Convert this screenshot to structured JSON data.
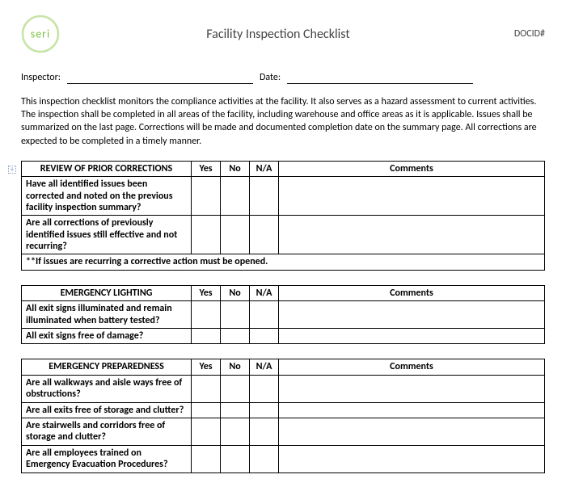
{
  "header": {
    "logo_text": "seri",
    "title": "Facility Inspection Checklist",
    "docid": "DOCID#"
  },
  "fields": {
    "inspector_label": "Inspector:",
    "date_label": "Date:"
  },
  "intro": "This inspection checklist monitors the compliance activities at the facility.  It also serves as a hazard assessment to current activities.  The inspection shall be completed in all areas of the facility, including warehouse and office areas as it is applicable.  Issues shall be summarized on the last page.  Corrections will be made and documented completion date on the summary page.   All corrections are expected to be completed in a timely manner.",
  "columns": {
    "yes": "Yes",
    "no": "No",
    "na": "N/A",
    "comments": "Comments"
  },
  "sections": {
    "prior": {
      "title": "REVIEW OF PRIOR CORRECTIONS",
      "items": [
        "Have all identified issues been corrected and noted on the previous facility inspection summary?",
        "Are all corrections of previously identified issues still effective and not recurring?"
      ],
      "footnote": "**If issues are recurring a corrective action must be opened."
    },
    "lighting": {
      "title": "EMERGENCY LIGHTING",
      "items": [
        "All exit signs illuminated and remain illuminated when battery tested?",
        "All exit signs free of damage?"
      ]
    },
    "prepared": {
      "title": "EMERGENCY PREPAREDNESS",
      "items": [
        "Are all walkways and aisle ways free of obstructions?",
        "Are all exits free of storage and clutter?",
        "Are stairwells and corridors free of storage and clutter?",
        "Are all employees trained on Emergency Evacuation Procedures?"
      ]
    }
  }
}
